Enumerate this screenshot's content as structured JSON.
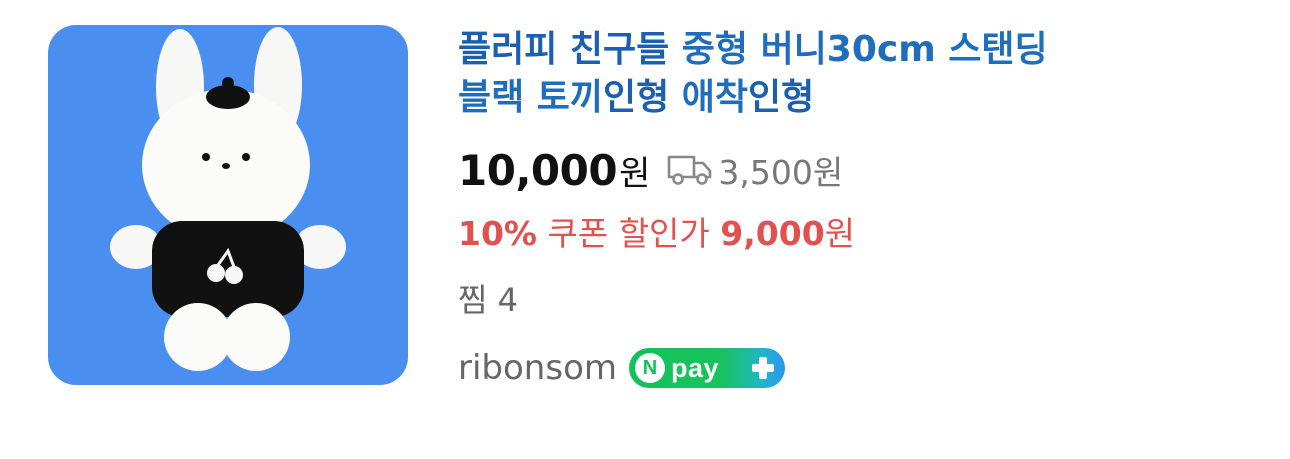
{
  "product": {
    "image_alt": "white bunny plush with black sweater and beret",
    "title_parts": {
      "p1": "플러피 친구들",
      "p2": " 중형 버니30cm 스탠딩",
      "p3": "블랙 토끼",
      "p4": "인형",
      "p5": " 애착",
      "p6": "인형"
    },
    "price": "10,000",
    "price_unit": "원",
    "shipping_icon": "truck-icon",
    "shipping_fee": "3,500원",
    "coupon": {
      "percent": "10%",
      "label": " 쿠폰 할인가 ",
      "price": "9,000",
      "unit": "원"
    },
    "zzim": "찜 4",
    "seller": "ribonsom",
    "npay": {
      "n": "N",
      "pay": "pay",
      "icon": "plus-icon"
    }
  },
  "colors": {
    "title_blue": "#1f6dbd",
    "thumb_bg": "#4a8ff0",
    "coupon_red": "#e0524f",
    "npay_green": "#12c15a"
  }
}
